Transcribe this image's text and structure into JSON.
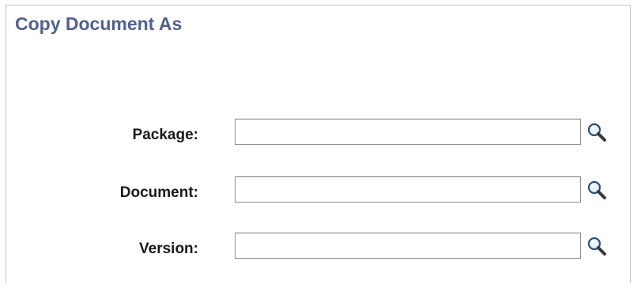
{
  "page": {
    "title": "Copy Document As"
  },
  "form": {
    "fields": [
      {
        "label": "Package:",
        "value": ""
      },
      {
        "label": "Document:",
        "value": ""
      },
      {
        "label": "Version:",
        "value": ""
      }
    ]
  },
  "icons": {
    "lookup": "magnifier-lookup-icon"
  },
  "colors": {
    "title": "#50618e",
    "label": "#1a1a1a",
    "field_border": "#8f8f8f"
  }
}
